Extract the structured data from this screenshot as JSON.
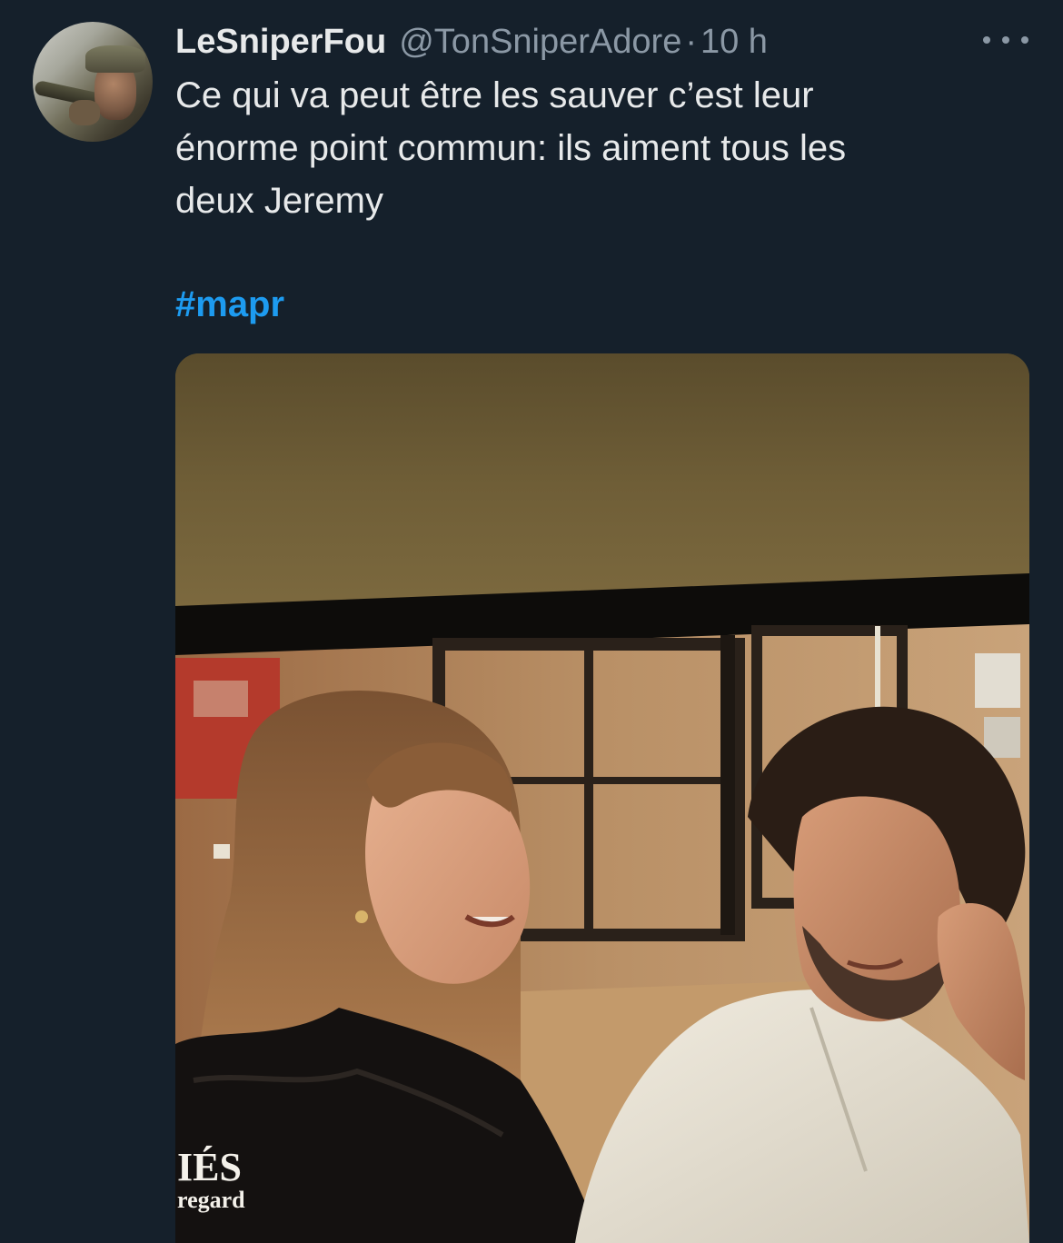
{
  "tweet": {
    "display_name": "LeSniperFou",
    "handle": "@TonSniperAdore",
    "separator": "·",
    "time": "10 h",
    "text_lines": [
      "Ce qui va peut être les sauver c’est leur",
      "énorme point commun: ils aiment tous les",
      "deux Jeremy"
    ],
    "hashtag": "#mapr",
    "media": {
      "overlay_text_main": "IÉS",
      "overlay_text_sub": "regard"
    }
  },
  "icons": {
    "more": "more-horizontal-icon",
    "avatar": "user-avatar"
  },
  "colors": {
    "background": "#15202b",
    "text": "#e7e9ea",
    "secondary_text": "#8b98a5",
    "link": "#1d9bf0"
  }
}
